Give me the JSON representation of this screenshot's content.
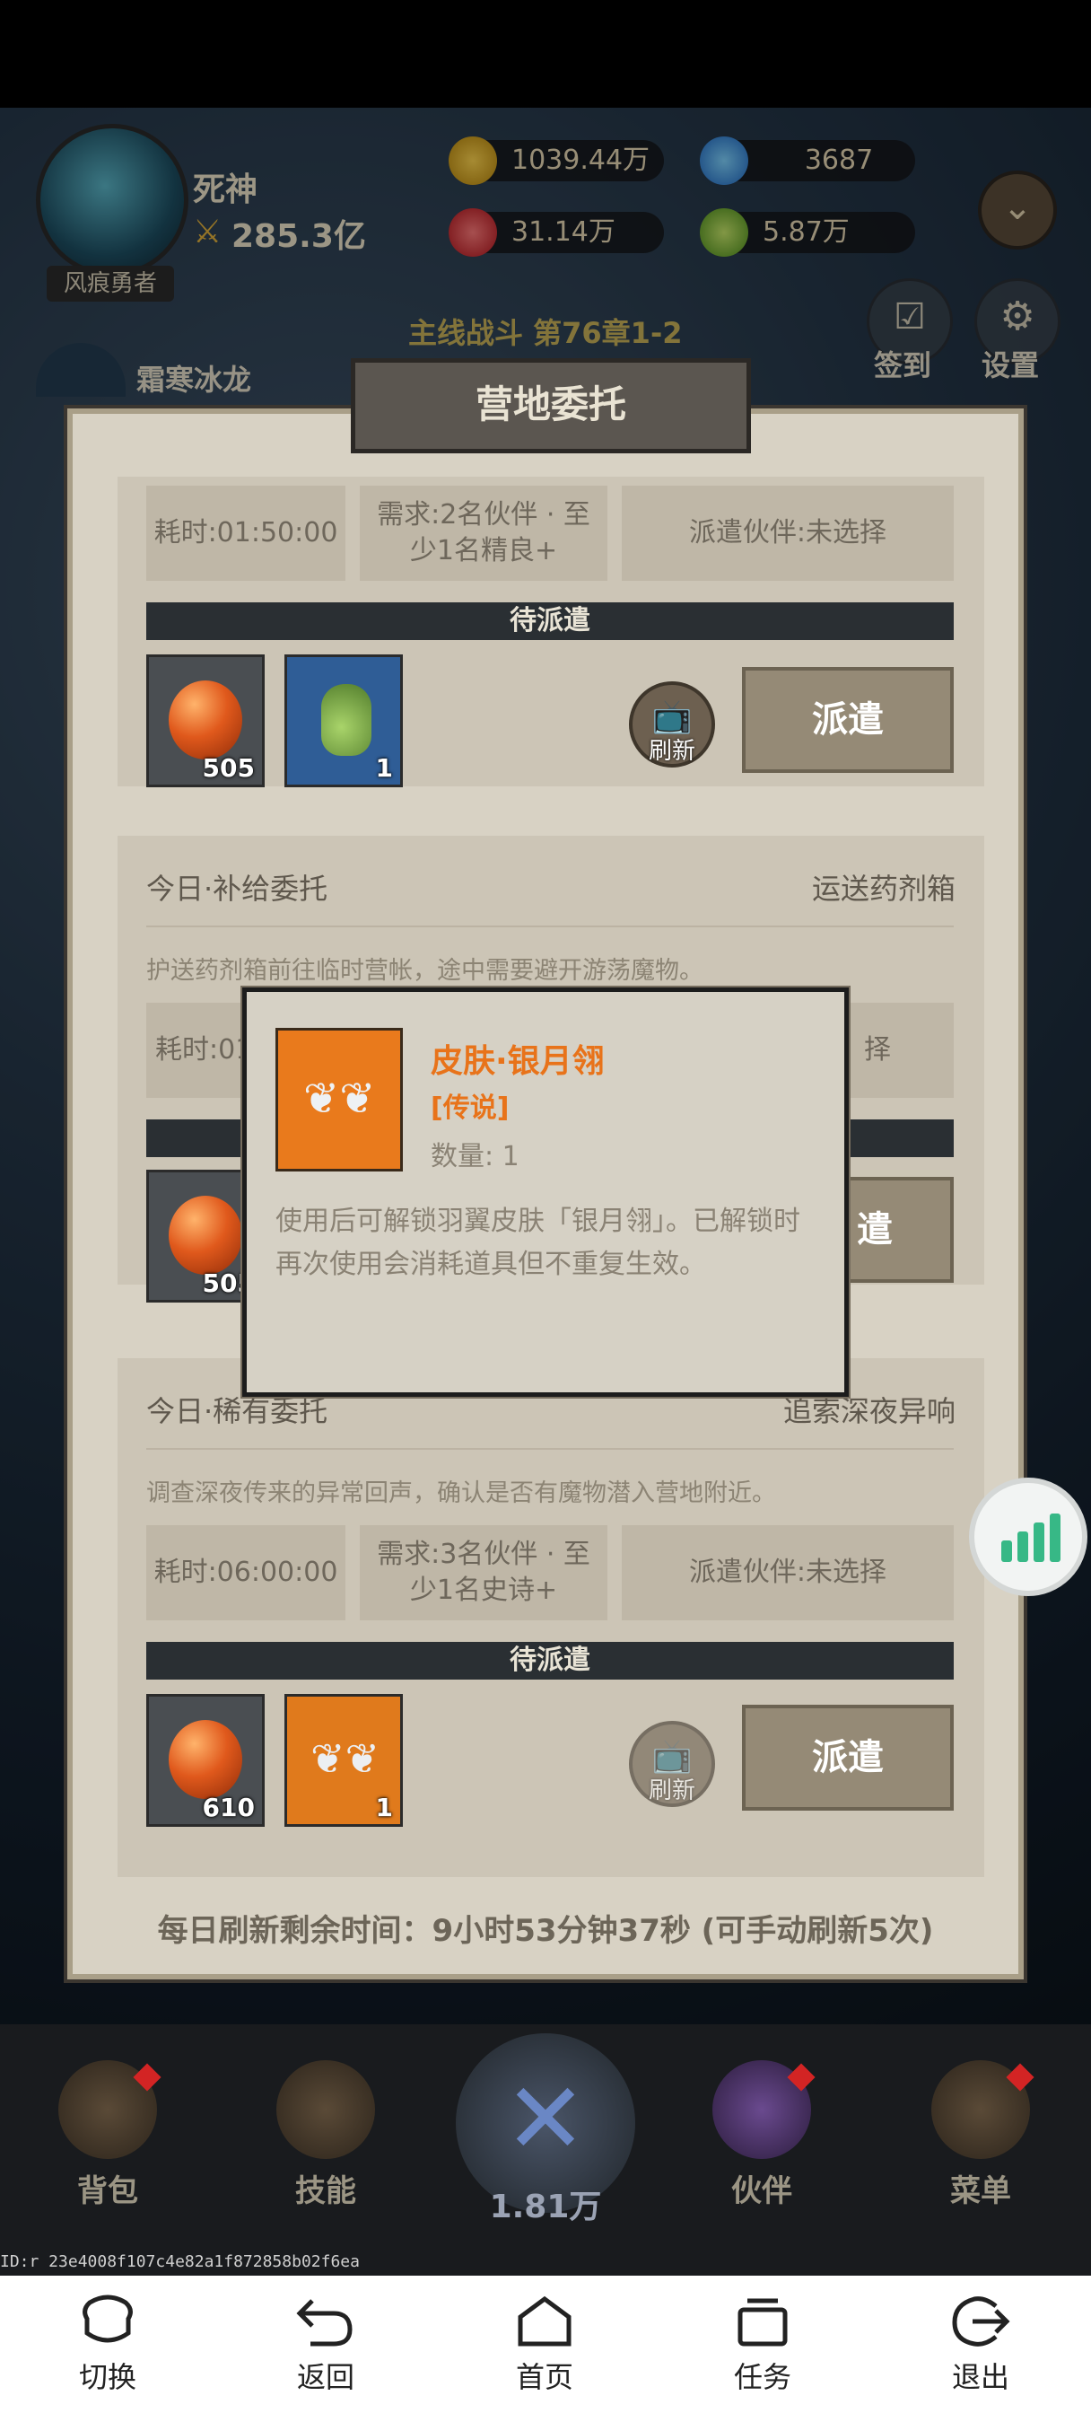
{
  "player": {
    "name": "死神",
    "power": "285.3亿",
    "title": "风痕勇者",
    "companion": "霜寒冰龙"
  },
  "resources": {
    "gold": "1039.44万",
    "gem_blue": "3687",
    "gem_red": "31.14万",
    "gem_green": "5.87万"
  },
  "stage": "主线战斗 第76章1-2",
  "side_menu": {
    "checkin": "签到",
    "settings": "设置"
  },
  "panel": {
    "title": "营地委托",
    "card1": {
      "time": "耗时:01:50:00",
      "requirement": "需求:2名伙伴 · 至少1名精良+",
      "dispatch_partner": "派遣伙伴:未选择",
      "status": "待派遣",
      "rewards": [
        {
          "icon": "fire-orb-icon",
          "count": "505"
        },
        {
          "icon": "potion-bottle-icon",
          "count": "1"
        }
      ],
      "refresh_label": "刷新",
      "dispatch_label": "派遣"
    },
    "card2": {
      "title": "今日·补给委托",
      "subtitle": "运送药剂箱",
      "desc": "护送药剂箱前往临时营帐，途中需要避开游荡魔物。",
      "time_partial": "耗时:01",
      "dispatch_partial": "择",
      "reward_count": "505",
      "dispatch_partial_btn": "遣"
    },
    "card3": {
      "title": "今日·稀有委托",
      "subtitle": "追索深夜异响",
      "desc": "调查深夜传来的异常回声，确认是否有魔物潜入营地附近。",
      "time": "耗时:06:00:00",
      "requirement": "需求:3名伙伴 · 至少1名史诗+",
      "dispatch_partner": "派遣伙伴:未选择",
      "status": "待派遣",
      "rewards": [
        {
          "icon": "fire-orb-icon",
          "count": "610"
        },
        {
          "icon": "silver-wings-icon",
          "count": "1"
        }
      ],
      "refresh_label": "刷新",
      "dispatch_label": "派遣"
    },
    "footer": "每日刷新剩余时间：9小时53分钟37秒 (可手动刷新5次)"
  },
  "popup": {
    "name": "皮肤·银月翎",
    "rarity": "[传说]",
    "quantity": "数量: 1",
    "description": "使用后可解锁羽翼皮肤「银月翎」。已解锁时再次使用会消耗道具但不重复生效。"
  },
  "game_nav": {
    "backpack": "背包",
    "skills": "技能",
    "battle_value": "1.81万",
    "partners": "伙伴",
    "menu": "菜单"
  },
  "debug_id": "ID:r 23e4008f107c4e82a1f872858b02f6ea",
  "system_nav": {
    "switch": "切换",
    "back": "返回",
    "home": "首页",
    "tasks": "任务",
    "exit": "退出"
  },
  "colors": {
    "rarity_orange": "#e8731a",
    "status_bar": "#2a2f33",
    "panel_bg": "#d8d2c4"
  }
}
